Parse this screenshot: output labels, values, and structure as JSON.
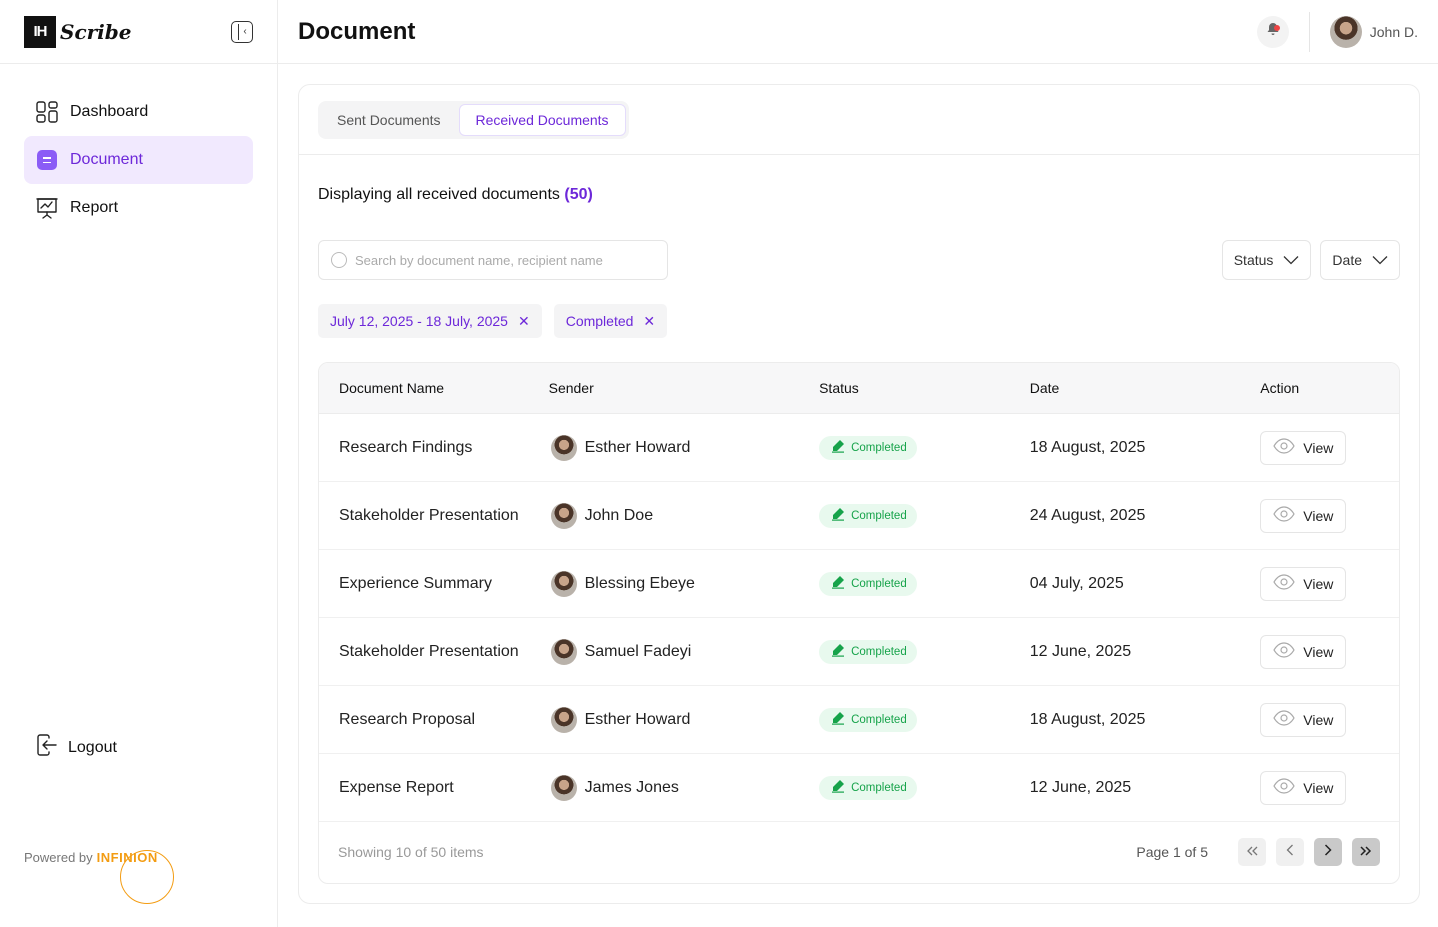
{
  "brand": {
    "logo_mark": "IH",
    "logo_text": "Scribe"
  },
  "sidebar": {
    "items": [
      {
        "label": "Dashboard",
        "icon": "dashboard-grid-icon",
        "active": false
      },
      {
        "label": "Document",
        "icon": "document-icon",
        "active": true
      },
      {
        "label": "Report",
        "icon": "presentation-chart-icon",
        "active": false
      }
    ],
    "logout_label": "Logout",
    "powered_by": "Powered by",
    "powered_brand": "INFINION"
  },
  "header": {
    "title": "Document",
    "user_name": "John D."
  },
  "tabs": [
    {
      "label": "Sent Documents",
      "active": false
    },
    {
      "label": "Received Documents",
      "active": true
    }
  ],
  "summary": {
    "text": "Displaying all received documents",
    "count": "(50)"
  },
  "search": {
    "placeholder": "Search by document name, recipient name",
    "value": ""
  },
  "filters": {
    "status_label": "Status",
    "date_label": "Date"
  },
  "chips": [
    {
      "label": "July 12, 2025 - 18 July, 2025"
    },
    {
      "label": "Completed"
    }
  ],
  "table": {
    "columns": [
      "Document Name",
      "Sender",
      "Status",
      "Date",
      "Action"
    ],
    "rows": [
      {
        "name": "Research Findings",
        "sender": "Esther Howard",
        "status": "Completed",
        "date": "18 August, 2025",
        "action": "View"
      },
      {
        "name": "Stakeholder Presentation",
        "sender": "John Doe",
        "status": "Completed",
        "date": "24 August, 2025",
        "action": "View"
      },
      {
        "name": "Experience Summary",
        "sender": "Blessing Ebeye",
        "status": "Completed",
        "date": "04 July, 2025",
        "action": "View"
      },
      {
        "name": "Stakeholder Presentation",
        "sender": "Samuel Fadeyi",
        "status": "Completed",
        "date": "12 June, 2025",
        "action": "View"
      },
      {
        "name": "Research Proposal",
        "sender": "Esther Howard",
        "status": "Completed",
        "date": "18 August, 2025",
        "action": "View"
      },
      {
        "name": "Expense Report",
        "sender": "James Jones",
        "status": "Completed",
        "date": "12 June, 2025",
        "action": "View"
      }
    ],
    "showing": "Showing 10 of 50 items",
    "page_info": "Page 1 of 5"
  },
  "colors": {
    "accent": "#6d28d9",
    "accent_bg": "#f1e9fe",
    "success": "#16a34a",
    "success_bg": "#e8f9ee",
    "brand_orange": "#f39c12"
  }
}
